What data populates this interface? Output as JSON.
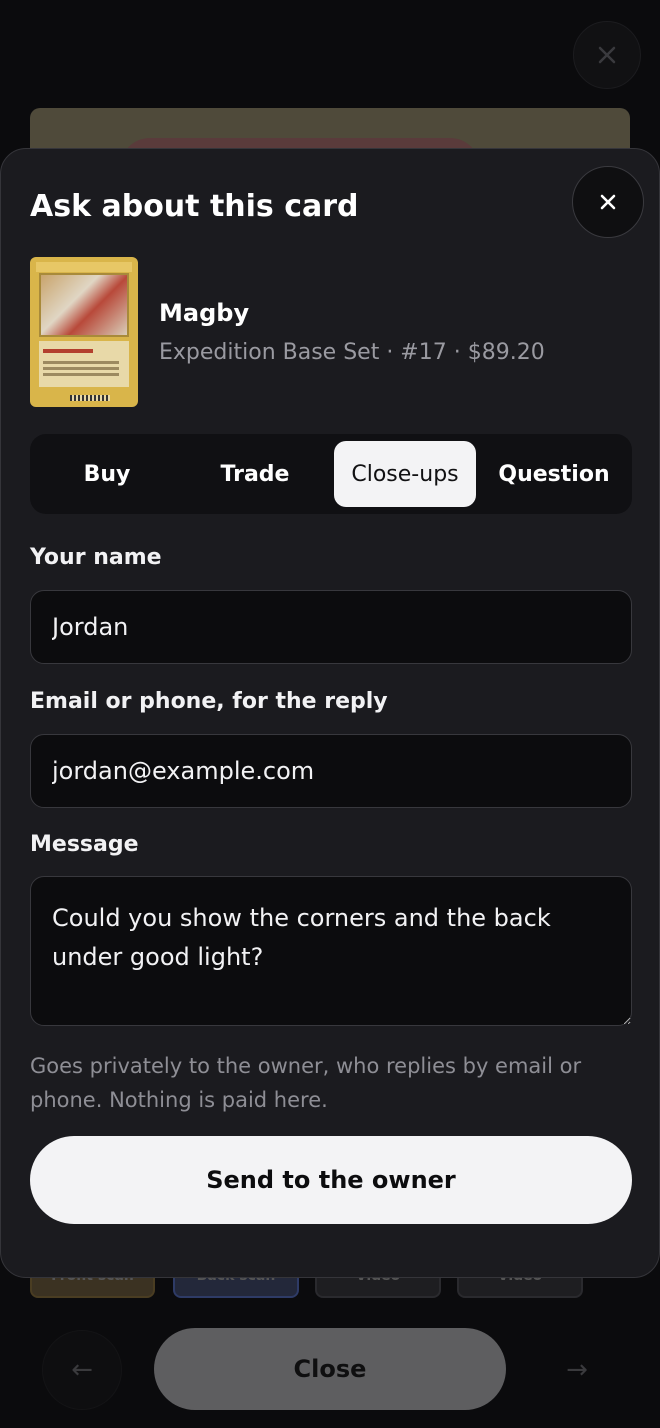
{
  "background": {
    "close_label": "Close",
    "prev_arrow": "←",
    "next_arrow": "→",
    "thumbnails": [
      "Front scan",
      "Back scan",
      "Video",
      "Video"
    ]
  },
  "modal": {
    "title": "Ask about this card",
    "card": {
      "name": "Magby",
      "meta": "Expedition Base Set · #17 · $89.20"
    },
    "tabs": [
      {
        "label": "Buy",
        "selected": false
      },
      {
        "label": "Trade",
        "selected": false
      },
      {
        "label": "Close-ups",
        "selected": true
      },
      {
        "label": "Question",
        "selected": false
      }
    ],
    "name_label": "Your name",
    "name_value": "Jordan",
    "contact_label": "Email or phone, for the reply",
    "contact_value": "jordan@example.com",
    "message_label": "Message",
    "message_value": "Could you show the corners and the back under good light?",
    "hint": "Goes privately to the owner, who replies by email or phone. Nothing is paid here.",
    "send_label": "Send to the owner"
  },
  "colors": {
    "sheet_bg": "#1b1b1f",
    "selected_tab_bg": "#f3f3f5",
    "primary_button_bg": "#f3f3f5"
  }
}
